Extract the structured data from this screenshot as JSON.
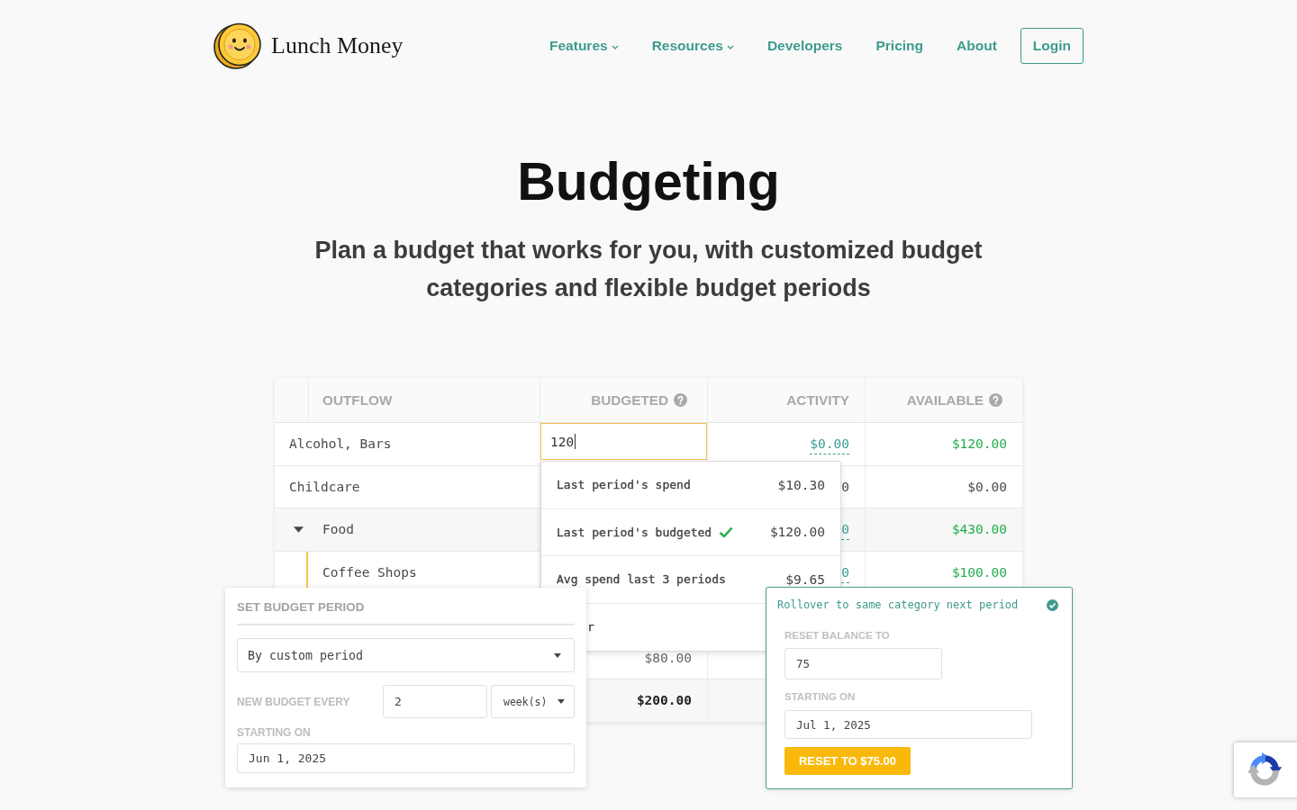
{
  "nav": {
    "brand": "Lunch Money",
    "links": [
      {
        "label": "Features",
        "has_menu": true
      },
      {
        "label": "Resources",
        "has_menu": true
      },
      {
        "label": "Developers",
        "has_menu": false
      },
      {
        "label": "Pricing",
        "has_menu": false
      },
      {
        "label": "About",
        "has_menu": false
      }
    ],
    "login": "Login"
  },
  "hero": {
    "title": "Budgeting",
    "subtitle": "Plan a budget that works for you, with customized budget categories and flexible budget periods"
  },
  "budget_table": {
    "columns": [
      {
        "label": "OUTFLOW",
        "help": false
      },
      {
        "label": "BUDGETED",
        "help": true
      },
      {
        "label": "ACTIVITY",
        "help": false
      },
      {
        "label": "AVAILABLE",
        "help": true
      }
    ],
    "rows": [
      {
        "name": "Alcohol, Bars",
        "budgeted": "120",
        "editing": true,
        "activity": "$0.00",
        "activity_linked": true,
        "available": "$120.00",
        "available_positive": true
      },
      {
        "name": "Childcare",
        "activity": "0",
        "activity_linked": false,
        "available": "$0.00",
        "available_positive": false
      },
      {
        "name": "Food",
        "expanded": true,
        "activity": "0",
        "activity_linked": true,
        "available": "$430.00",
        "available_positive": true,
        "children": [
          {
            "name": "Coffee Shops",
            "activity": "0",
            "activity_linked": true,
            "available": "$100.00",
            "available_positive": true
          }
        ]
      }
    ],
    "lower_rows": [
      {
        "kind": "row",
        "budgeted": "$80.00"
      },
      {
        "kind": "total",
        "budgeted": "$200.00"
      }
    ]
  },
  "suggestions_menu": {
    "options": [
      {
        "kind": "option",
        "label": "Last period's spend",
        "amount": "$10.30",
        "selected": false
      },
      {
        "kind": "option",
        "label": "Last period's budgeted",
        "amount": "$120.00",
        "selected": true
      },
      {
        "kind": "option",
        "label": "Avg spend last 3 periods",
        "amount": "$9.65",
        "selected": false
      },
      {
        "kind": "covered",
        "label": "r",
        "selected": false
      }
    ]
  },
  "budget_period_panel": {
    "title": "SET BUDGET PERIOD",
    "period": "By custom period",
    "every_label": "NEW BUDGET EVERY",
    "every": "2",
    "unit": "week(s)",
    "start_label": "STARTING ON",
    "start": "Jun 1, 2025"
  },
  "rollover_panel": {
    "label": "Rollover to same category next period",
    "checked": true,
    "reset_label": "RESET BALANCE TO",
    "reset_value": "75",
    "start_label": "STARTING ON",
    "start": "Jul 1, 2025",
    "button": "RESET TO $75.00"
  }
}
